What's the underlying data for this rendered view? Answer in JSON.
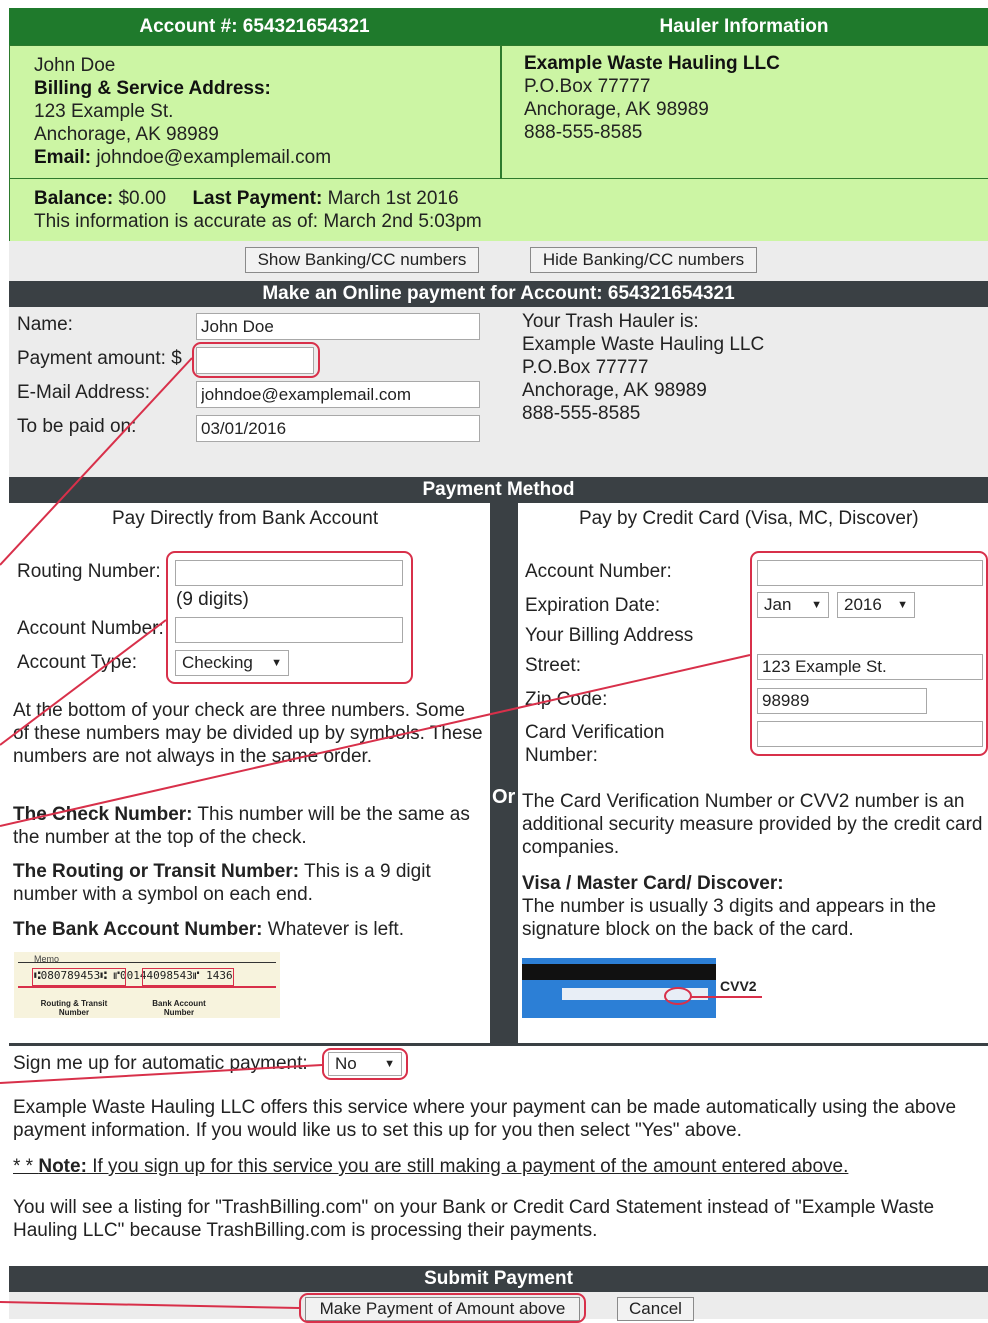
{
  "account": {
    "header": "Account #: 654321654321",
    "name": "John Doe",
    "address_label": "Billing & Service Address:",
    "street": "123 Example St.",
    "city": "Anchorage, AK 98989",
    "email_label": "Email:",
    "email": "johndoe@examplemail.com",
    "balance_label": "Balance:",
    "balance": "$0.00",
    "last_payment_label": "Last Payment:",
    "last_payment": "March 1st 2016",
    "accuracy": "This information is accurate as of: March 2nd 5:03pm"
  },
  "hauler": {
    "header": "Hauler Information",
    "name": "Example Waste Hauling LLC",
    "box": "P.O.Box 77777",
    "city": "Anchorage, AK 98989",
    "phone": "888-555-8585"
  },
  "toggles": {
    "show": "Show Banking/CC numbers",
    "hide": "Hide Banking/CC numbers"
  },
  "payment": {
    "title": "Make an Online payment for Account: 654321654321",
    "name_label": "Name:",
    "name_value": "John Doe",
    "amount_label": "Payment amount: $",
    "amount_value": "",
    "email_label": "E-Mail Address:",
    "email_value": "johndoe@examplemail.com",
    "date_label": "To be paid on:",
    "date_value": "03/01/2016",
    "hauler_intro": "Your Trash Hauler is:",
    "hauler_name": "Example Waste Hauling LLC",
    "hauler_box": "P.O.Box 77777",
    "hauler_city": "Anchorage, AK 98989",
    "hauler_phone": "888-555-8585"
  },
  "method": {
    "title": "Payment Method",
    "bank": {
      "title": "Pay Directly from Bank Account",
      "routing_label": "Routing Number:",
      "routing_hint": "(9 digits)",
      "account_label": "Account Number:",
      "type_label": "Account Type:",
      "type_value": "Checking",
      "info": "At the bottom of your check are three numbers. Some of these numbers may be divided up by symbols. These numbers are not always in the same order.",
      "check_bold": "The Check Number:",
      "check_text": " This number will be the same as the number at the top of the check.",
      "routing_bold": "The Routing or Transit Number:",
      "routing_text": " This is a 9 digit number with a symbol on each end.",
      "acct_bold": "The Bank Account Number:",
      "acct_text": " Whatever is left.",
      "check_img": {
        "memo": "Memo",
        "line": "⑆080789453⑆  ⑈00144098543⑈  1436",
        "cap1": "Routing & Transit Number",
        "cap2": "Bank Account Number"
      }
    },
    "or": "Or",
    "card": {
      "title": "Pay by Credit Card (Visa, MC, Discover)",
      "account_label": "Account Number:",
      "exp_label": "Expiration Date:",
      "exp_month": "Jan",
      "exp_year": "2016",
      "billing_label": "Your Billing Address",
      "street_label": "Street:",
      "street_value": "123 Example St.",
      "zip_label": "Zip Code:",
      "zip_value": "98989",
      "cvv_label": "Card Verification Number:",
      "info": "The Card Verification Number or CVV2 number is an additional security measure provided by the credit card companies.",
      "brands": "Visa / Master Card/ Discover:",
      "brands_text": "The number is usually 3 digits and appears in the signature block on the back of the card.",
      "cvv_tag": "CVV2"
    }
  },
  "auto": {
    "label": "Sign me up for automatic payment:",
    "value": "No",
    "text": "Example Waste Hauling LLC offers this service where your payment can be made automatically using the above payment information. If you would like us to set this up for you then select \"Yes\" above.",
    "note_prefix": "* * ",
    "note_bold": "Note:",
    "note_text": " If you sign up for this service you are still making a payment of the amount entered above.",
    "statement": "You will see a listing for \"TrashBilling.com\" on your Bank or Credit Card Statement instead of \"Example Waste Hauling LLC\" because TrashBilling.com is processing their payments."
  },
  "submit": {
    "title": "Submit Payment",
    "pay": "Make Payment of Amount above",
    "cancel": "Cancel"
  },
  "colors": {
    "header_green": "#1f7a2c",
    "panel_green": "#ccf5a4",
    "bar_dark": "#3a4044",
    "highlight": "#d8304a"
  }
}
